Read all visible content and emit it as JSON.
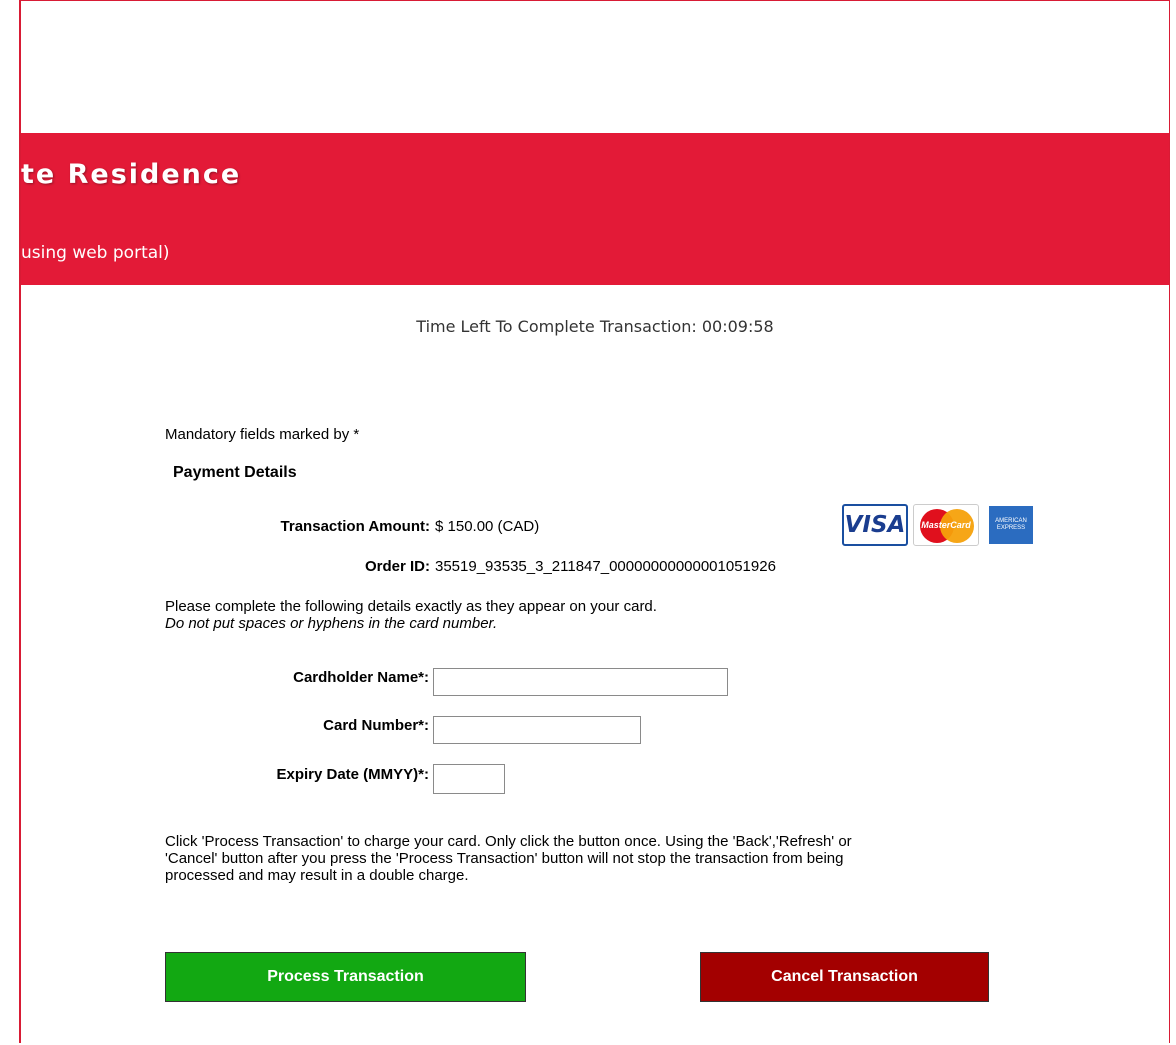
{
  "banner": {
    "title": "te Residence",
    "subtitle": "using web portal)",
    "color": "#e31a37"
  },
  "timer": {
    "label": "Time Left To Complete Transaction:",
    "value": "00:09:58"
  },
  "form": {
    "mandatory_note": "Mandatory fields marked by *",
    "section_title": "Payment Details",
    "amount_label": "Transaction Amount:",
    "amount_value": "$ 150.00 (CAD)",
    "order_label": "Order ID:",
    "order_value": "35519_93535_3_211847_00000000000001051926",
    "instructions": "Please complete the following details exactly as they appear on your card.",
    "instructions_note": "Do not put spaces or hyphens in the card number.",
    "cardholder_label": "Cardholder Name*:",
    "cardholder_value": "",
    "card_number_label": "Card Number*:",
    "card_number_value": "",
    "expiry_label": "Expiry Date (MMYY)*:",
    "expiry_value": "",
    "warning_line1": "Click 'Process Transaction' to charge your card. Only click the button once. Using the 'Back','Refresh' or",
    "warning_line2": "'Cancel' button after you press the 'Process Transaction' button will not stop the transaction from being",
    "warning_line3": "processed and may result in a double charge."
  },
  "cards": {
    "visa": "VISA",
    "mastercard": "MasterCard",
    "amex": "AMERICAN EXPRESS"
  },
  "buttons": {
    "process_label": "Process Transaction",
    "process_color": "#12a812",
    "cancel_label": "Cancel Transaction",
    "cancel_color": "#a30000"
  }
}
